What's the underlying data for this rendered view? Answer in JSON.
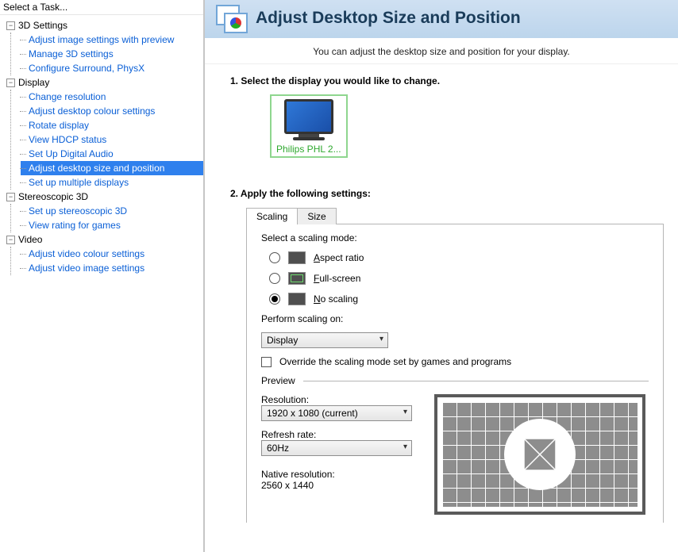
{
  "sidebar": {
    "title": "Select a Task...",
    "groups": [
      {
        "label": "3D Settings",
        "items": [
          "Adjust image settings with preview",
          "Manage 3D settings",
          "Configure Surround, PhysX"
        ]
      },
      {
        "label": "Display",
        "items": [
          "Change resolution",
          "Adjust desktop colour settings",
          "Rotate display",
          "View HDCP status",
          "Set Up Digital Audio",
          "Adjust desktop size and position",
          "Set up multiple displays"
        ],
        "selected_index": 5
      },
      {
        "label": "Stereoscopic 3D",
        "items": [
          "Set up stereoscopic 3D",
          "View rating for games"
        ]
      },
      {
        "label": "Video",
        "items": [
          "Adjust video colour settings",
          "Adjust video image settings"
        ]
      }
    ]
  },
  "header": {
    "title": "Adjust Desktop Size and Position"
  },
  "subtitle": "You can adjust the desktop size and position for your display.",
  "step1": {
    "label": "1. Select the display you would like to change.",
    "display_name": "Philips PHL 2..."
  },
  "step2": {
    "label": "2. Apply the following settings:"
  },
  "tabs": {
    "scaling": "Scaling",
    "size": "Size"
  },
  "scaling": {
    "mode_label": "Select a scaling mode:",
    "options": {
      "aspect": "Aspect ratio",
      "full": "Full-screen",
      "none": "No scaling"
    },
    "selected": "none",
    "perform_label": "Perform scaling on:",
    "perform_value": "Display",
    "override_label": "Override the scaling mode set by games and programs",
    "preview_label": "Preview",
    "resolution_label": "Resolution:",
    "resolution_value": "1920 x 1080 (current)",
    "refresh_label": "Refresh rate:",
    "refresh_value": "60Hz",
    "native_label": "Native resolution:",
    "native_value": "2560 x 1440"
  }
}
